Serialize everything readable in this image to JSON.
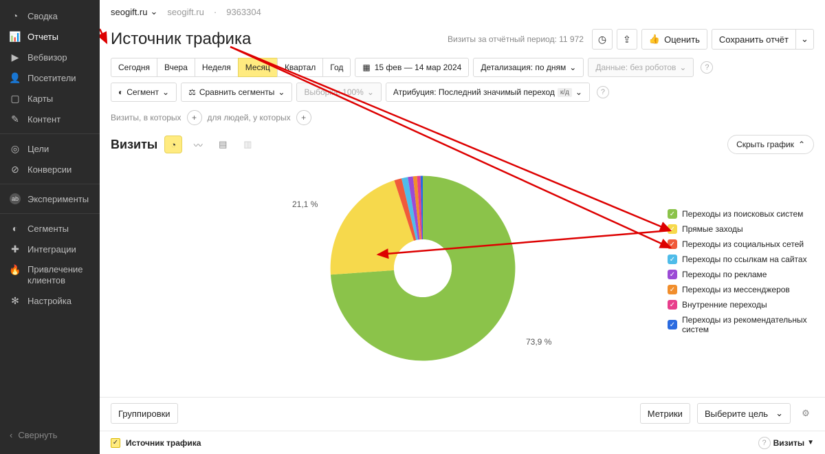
{
  "sidebar": {
    "items": [
      {
        "label": "Сводка",
        "icon": "◔"
      },
      {
        "label": "Отчеты",
        "icon": "📊",
        "active": true
      },
      {
        "label": "Вебвизор",
        "icon": "▶"
      },
      {
        "label": "Посетители",
        "icon": "👤"
      },
      {
        "label": "Карты",
        "icon": "▢"
      },
      {
        "label": "Контент",
        "icon": "✎"
      }
    ],
    "groups2": [
      {
        "label": "Цели",
        "icon": "◎"
      },
      {
        "label": "Конверсии",
        "icon": "⊘"
      }
    ],
    "groups3": [
      {
        "label": "Эксперименты",
        "icon": "ab"
      }
    ],
    "groups4": [
      {
        "label": "Сегменты",
        "icon": "◐"
      },
      {
        "label": "Интеграции",
        "icon": "✚"
      },
      {
        "label": "Привлечение клиентов",
        "icon": "🔥"
      },
      {
        "label": "Настройка",
        "icon": "✻"
      }
    ],
    "collapse": "Свернуть"
  },
  "top": {
    "site": "seogift.ru",
    "site_sub": "seogift.ru",
    "counter_id": "9363304",
    "page_title": "Источник трафика",
    "period_text": "Визиты за отчётный период: 11 972",
    "rate_label": "Оценить",
    "save_label": "Сохранить отчёт"
  },
  "range": {
    "today": "Сегодня",
    "yesterday": "Вчера",
    "week": "Неделя",
    "month": "Месяц",
    "quarter": "Квартал",
    "year": "Год",
    "dates": "15 фев — 14 мар 2024",
    "detail": "Детализация: по дням",
    "robots": "Данные: без роботов"
  },
  "segments": {
    "segment": "Сегмент",
    "compare": "Сравнить сегменты",
    "sampling": "Выборка: 100%",
    "attribution": "Атрибуция: Последний значимый переход",
    "attribution_chip": "к/д"
  },
  "conditions": {
    "visits_where": "Визиты, в которых",
    "people_where": "для людей, у которых"
  },
  "viz": {
    "metric_title": "Визиты",
    "hide": "Скрыть график"
  },
  "donut": {
    "pct_main": "73,9 %",
    "pct_second": "21,1 %"
  },
  "legend": [
    {
      "label": "Переходы из поисковых систем",
      "color": "#8bc34a"
    },
    {
      "label": "Прямые заходы",
      "color": "#f6d94c"
    },
    {
      "label": "Переходы из социальных сетей",
      "color": "#f05a3a"
    },
    {
      "label": "Переходы по ссылкам на сайтах",
      "color": "#4fbce9"
    },
    {
      "label": "Переходы по рекламе",
      "color": "#9b4bd6"
    },
    {
      "label": "Переходы из мессенджеров",
      "color": "#f18e2c"
    },
    {
      "label": "Внутренние переходы",
      "color": "#e83e8c"
    },
    {
      "label": "Переходы из рекомендательных систем",
      "color": "#2b6be0"
    }
  ],
  "bottom": {
    "groupings": "Группировки",
    "metrics": "Метрики",
    "goal_select": "Выберите цель"
  },
  "table": {
    "header": "Источник трафика",
    "right_col": "Визиты"
  },
  "chart_data": {
    "type": "pie",
    "title": "Визиты",
    "series": [
      {
        "name": "Переходы из поисковых систем",
        "value": 73.9,
        "color": "#8bc34a"
      },
      {
        "name": "Прямые заходы",
        "value": 21.1,
        "color": "#f6d94c"
      },
      {
        "name": "Переходы из социальных сетей",
        "value": 1.3,
        "color": "#f05a3a"
      },
      {
        "name": "Переходы по ссылкам на сайтах",
        "value": 1.1,
        "color": "#4fbce9"
      },
      {
        "name": "Переходы по рекламе",
        "value": 0.9,
        "color": "#9b4bd6"
      },
      {
        "name": "Переходы из мессенджеров",
        "value": 0.7,
        "color": "#f18e2c"
      },
      {
        "name": "Внутренние переходы",
        "value": 0.6,
        "color": "#e83e8c"
      },
      {
        "name": "Переходы из рекомендательных систем",
        "value": 0.4,
        "color": "#2b6be0"
      }
    ]
  }
}
